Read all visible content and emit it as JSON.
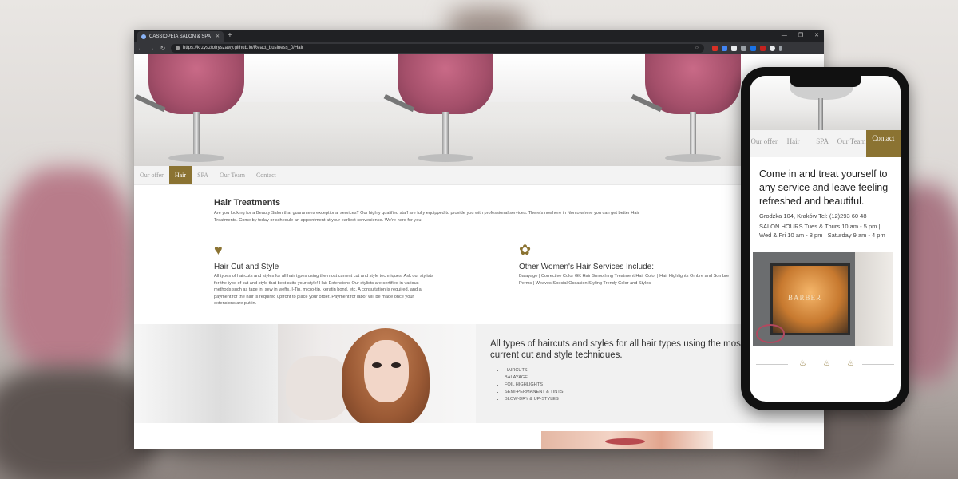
{
  "browser": {
    "tab_title": "CASSIOPEIA SALON & SPA",
    "new_tab": "+",
    "url": "https://krzysztofryszawy.github.io/React_business_0/Hair",
    "window_controls": [
      "—",
      "❐",
      "✕"
    ]
  },
  "site_nav": {
    "items": [
      "Our offer",
      "Hair",
      "SPA",
      "Our Team",
      "Contact"
    ],
    "active": "Hair"
  },
  "treatments": {
    "title": "Hair Treatments",
    "text": "Are you looking for a Beauty Salon that guarantees exceptional services? Our highly qualified staff are fully equipped to provide you with professional services. There's nowhere in Norco where you can get better Hair Treatments. Come by today or schedule an appointment at your earliest convenience. We're here for you."
  },
  "col1": {
    "icon": "heart-icon",
    "title": "Hair Cut and Style",
    "text": "All types of haircuts and styles for all hair types using the most current cut and style techniques. Ask our stylists for the type of cut and style that best suits your style! Hair Extensions Our stylists are certified in various methods such as tape in, sew in wefts, I-Tip, micro-tip, keratin bond, etc. A consultation is required, and a payment for the hair is required upfront to place your order. Payment for labor will be made once your extensions are put in."
  },
  "col2": {
    "icon": "flower-icon",
    "title": "Other Women's Hair Services Include:",
    "text": "Balayage | Corrective Color GK Hair Smoothing Treatment Hair Color | Hair Highlights Ombre and Sombre Perms | Weaves Special Occasion Styling Trendy Color and Styles"
  },
  "band": {
    "title": "All types of haircuts and styles for all hair types using the most current cut and style techniques.",
    "list": [
      "HAIRCUTS",
      "BALAYAGE",
      "FOIL HIGHLIGHTS",
      "SEMI-PERMANENT & TINTS",
      "BLOW-DRY & UP-STYLES"
    ]
  },
  "phone": {
    "nav": [
      "Our offer",
      "Hair",
      "SPA",
      "Our Team",
      "Contact"
    ],
    "active": "Contact",
    "heading": "Come in and treat yourself to any service and leave feeling refreshed and beautiful.",
    "address": "Grodzka 104, Kraków Tel: (12)293 60 48",
    "hours": "SALON HOURS Tues & Thurs 10 am - 5 pm | Wed & Fri 10 am - 8 pm | Saturday 9 am - 4 pm",
    "shop_sign": "BARBER"
  },
  "colors": {
    "accent": "#8b7332",
    "nav_bg": "#f3f3f3"
  }
}
